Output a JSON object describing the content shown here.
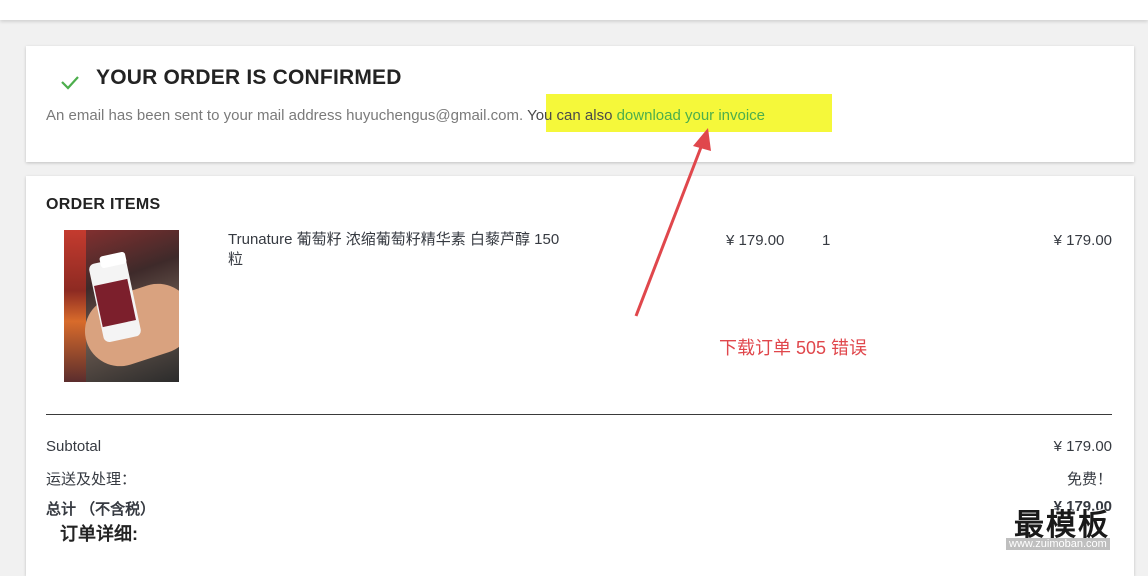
{
  "confirmation": {
    "title": "YOUR ORDER IS CONFIRMED",
    "email_text": "An email has been sent to your mail address huyuchengus@gmail.com.",
    "also_text": "You can also ",
    "invoice_link": "download your invoice"
  },
  "order_items": {
    "title": "ORDER ITEMS",
    "items": [
      {
        "name": "Trunature 葡萄籽 浓缩葡萄籽精华素 白藜芦醇 150粒",
        "unit_price": "¥ 179.00",
        "quantity": "1",
        "total": "¥ 179.00"
      }
    ]
  },
  "totals": {
    "subtotal_label": "Subtotal",
    "subtotal_value": "¥ 179.00",
    "shipping_label": "运送及处理：",
    "shipping_value": "免费！",
    "total_label": "总计 （不含税）",
    "total_value": "¥ 179.00"
  },
  "details_heading": "订单详细:",
  "annotation": {
    "text": "下载订单 505 错误",
    "color": "#e0474c"
  },
  "watermark": {
    "text": "最模板",
    "url": "www.zuimoban.com"
  },
  "colors": {
    "accent_green": "#4cae4c",
    "highlight_yellow": "#f5f83a"
  }
}
